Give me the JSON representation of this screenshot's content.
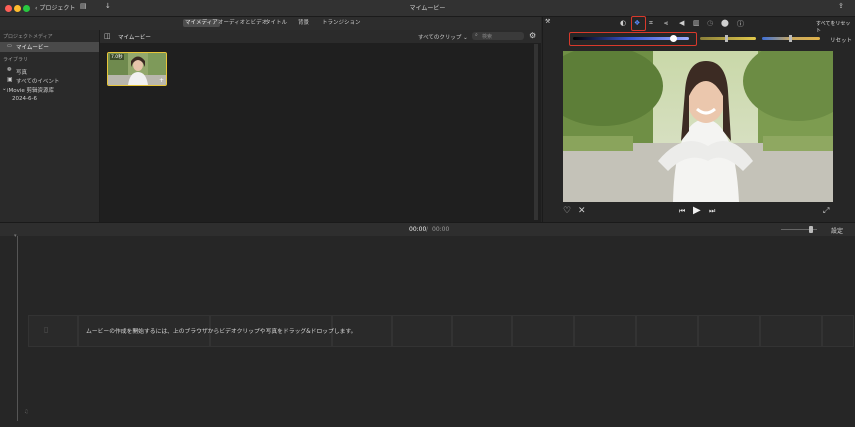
{
  "window": {
    "title": "マイムービー"
  },
  "toolbar": {
    "back_label": "プロジェクト"
  },
  "tabs": [
    "マイメディア",
    "オーディオとビデオ",
    "タイトル",
    "背景",
    "トランジション"
  ],
  "sidebar": {
    "project_media_header": "プロジェクトメディア",
    "project_item": "マイムービー",
    "library_header": "ライブラリ",
    "items": [
      "写真",
      "すべてのイベント"
    ],
    "library_name": "iMovie 剪辑资源库",
    "event": "2024-6-6"
  },
  "browser": {
    "title": "マイムービー",
    "filter": "すべてのクリップ",
    "search_placeholder": "検索",
    "clip_duration": "7.0秒"
  },
  "viewer": {
    "reset_all": "すべてをリセット",
    "reset": "リセット",
    "balance_value": 0.87
  },
  "timeline": {
    "current_time": "00:00",
    "separator": "/",
    "total_time": "00:00",
    "settings": "設定",
    "hint": "ムービーの作成を開始するには、上のブラウザからビデオクリップや写真をドラッグ&ドロップします。"
  },
  "colors": {
    "accent_red": "#d8392b",
    "clip_border": "#e8c53a",
    "slider_blue": "#3a57d6"
  }
}
